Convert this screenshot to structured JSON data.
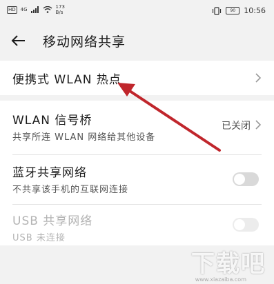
{
  "status": {
    "hd": "HD",
    "net": "4G",
    "speed_value": "173",
    "speed_unit": "B/s",
    "battery": "90",
    "time": "10:56"
  },
  "header": {
    "title": "移动网络共享"
  },
  "rows": {
    "hotspot": {
      "label": "便携式 WLAN 热点"
    },
    "bridge": {
      "label": "WLAN 信号桥",
      "sub": "共享所连 WLAN 网络给其他设备",
      "state": "已关闭"
    },
    "bt": {
      "label": "蓝牙共享网络",
      "sub": "不共享该手机的互联网连接"
    },
    "usb": {
      "label": "USB 共享网络",
      "sub": "USB 未连接"
    }
  },
  "watermark": {
    "text": "下载吧",
    "url": "www.xiazaiba.com"
  },
  "colors": {
    "arrow": "#c0262c",
    "background": "#f2f2f2"
  }
}
